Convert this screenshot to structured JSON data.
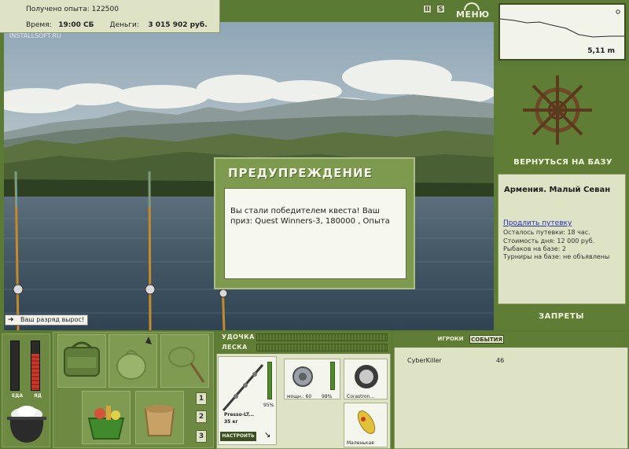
{
  "info": {
    "exp_label": "Получено опыта:",
    "exp_value": "122500",
    "time_label": "Время:",
    "time_value": "19:00 СБ",
    "money_label": "Деньги:",
    "money_value": "3 015 902 руб."
  },
  "watermark": "INSTALLSOFT.RU",
  "topbar": {
    "pause_icon": "pause-icon",
    "pause_glyph": "II",
    "sound_icon": "sound-icon",
    "sound_glyph": "S",
    "menu_label": "МЕНЮ"
  },
  "depth": {
    "value": "5,11 m"
  },
  "right": {
    "base_button": "ВЕРНУТЬСЯ НА БАЗУ",
    "location_title": "Армения. Малый Севан",
    "extend_link": "Продлить путевку",
    "lines": [
      "Осталось путевки: 18 час.",
      "Стоимость дня: 12 000 руб.",
      "Рыбаков на базе: 2",
      "Турниры на базе: не объявлены"
    ],
    "bans_button": "ЗАПРЕТЫ"
  },
  "dialog": {
    "title": "ПРЕДУПРЕЖДЕНИЕ",
    "message": "Вы стали победителем квеста! Ваш приз: Quest Winners-3, 180000 , Опыта"
  },
  "rank_notice": "Ваш разряд вырос!",
  "stats": {
    "food_label": "ЕДА",
    "poison_label": "ЯД",
    "food_level": 0.0,
    "poison_level": 0.75
  },
  "inventory": {
    "pages": [
      "1",
      "2",
      "3"
    ]
  },
  "tackle": {
    "rod_label": "УДОЧКА",
    "line_label": "ЛЕСКА",
    "rod_name": "Presso-LT...",
    "rod_weight": "35 кг",
    "rod_condition": "95%",
    "reel_power": "мощн.: 60",
    "reel_condition": "98%",
    "line_name": "Corastron...",
    "lure_name": "Маленькая",
    "tune_button": "НАСТРОИТЬ"
  },
  "players": {
    "tab_players": "ИГРОКИ",
    "tab_events": "СОБЫТИЯ",
    "rows": [
      {
        "name": "CyberKiller",
        "value": "46"
      }
    ]
  },
  "colors": {
    "panel_bg": "#dfe3c6",
    "frame_green": "#5b7a34",
    "dialog_green": "#7e9a4f",
    "link_blue": "#2030b0"
  }
}
